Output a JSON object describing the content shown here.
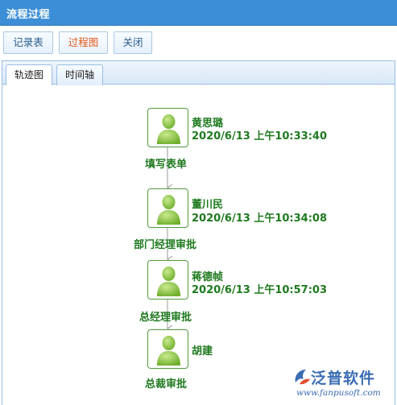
{
  "window": {
    "title": "流程过程"
  },
  "toolbar": {
    "buttons": [
      {
        "label": "记录表",
        "active": false
      },
      {
        "label": "过程图",
        "active": true
      },
      {
        "label": "关闭",
        "active": false
      }
    ]
  },
  "tabs": [
    {
      "label": "轨迹图",
      "active": true
    },
    {
      "label": "时间轴",
      "active": false
    }
  ],
  "flow": {
    "nodes": [
      {
        "person": "黄思璐",
        "time": "2020/6/13 上午10:33:40",
        "step": "填写表单",
        "icon": "user-avatar-icon"
      },
      {
        "person": "董川民",
        "time": "2020/6/13 上午10:34:08",
        "step": "部门经理审批",
        "icon": "user-avatar-icon"
      },
      {
        "person": "蒋德帧",
        "time": "2020/6/13 上午10:57:03",
        "step": "总经理审批",
        "icon": "user-avatar-icon"
      },
      {
        "person": "胡建",
        "time": "",
        "step": "总裁审批",
        "icon": "user-avatar-icon"
      }
    ],
    "colors": {
      "text": "#1f7a1f",
      "border": "#4f9a3a",
      "avatar": "#8cc63f",
      "connector": "#999999"
    }
  },
  "logo": {
    "brand": "泛普软件",
    "url": "www.fanpusoft.com",
    "icon": "fanpu-logo-icon"
  }
}
